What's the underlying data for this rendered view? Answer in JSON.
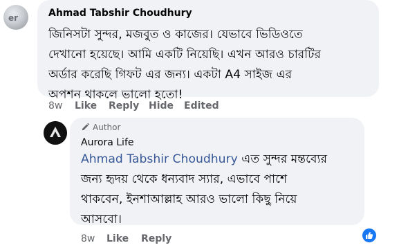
{
  "comment": {
    "author": "Ahmad Tabshir Choudhury",
    "lines": [
      "জিনিসটা সুন্দর, মজবুত ও কাজের। যেভাবে ভিডিওতে",
      "দেখানো হয়েছে। আমি একটি নিয়েছি। এখন আরও চারটির",
      "অর্ডার করেছি গিফট এর জন্য। একটা A4 সাইজ এর",
      "অপশন থাকলে ভালো হতো!"
    ],
    "actions": {
      "time": "8w",
      "like": "Like",
      "reply": "Reply",
      "hide": "Hide",
      "edited": "Edited"
    }
  },
  "reply": {
    "author_badge": "Author",
    "author": "Aurora Life",
    "mention": "Ahmad Tabshir Choudhury",
    "first_line_rest": " এত সুন্দর মন্তব্যের",
    "lines": [
      "জন্য হৃদয় থেকে ধন্যবাদ স্যার, এভাবে পাশে",
      "থাকবেন, ইনশাআল্লাহ আরও ভালো কিছু নিয়ে",
      "আসবো।"
    ],
    "actions": {
      "time": "8w",
      "like": "Like",
      "reply": "Reply"
    }
  },
  "colors": {
    "bubble": "#f0f2f5",
    "meta": "#65676b",
    "mention": "#385898",
    "like_badge": "#1877f2"
  },
  "icons": {
    "author_badge": "pencil-icon",
    "reaction": "thumbs-up-icon"
  }
}
